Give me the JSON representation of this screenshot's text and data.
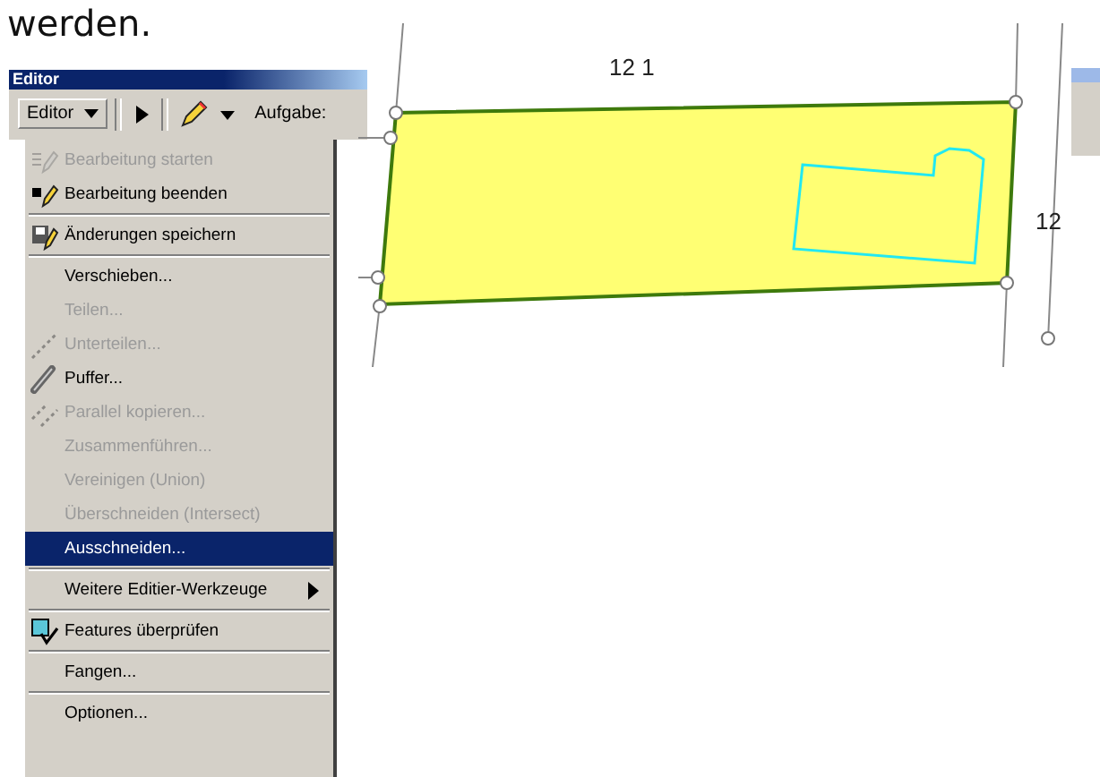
{
  "heading": "werden.",
  "editor_toolbar": {
    "title": "Editor",
    "menu_button": "Editor",
    "task_label": "Aufgabe:"
  },
  "menu": [
    {
      "kind": "item",
      "label": "Bearbeitung starten",
      "disabled": true,
      "selected": false
    },
    {
      "kind": "item",
      "label": "Bearbeitung beenden",
      "disabled": false,
      "selected": false
    },
    {
      "kind": "separator"
    },
    {
      "kind": "item",
      "label": "Änderungen speichern",
      "disabled": false,
      "selected": false
    },
    {
      "kind": "separator"
    },
    {
      "kind": "item",
      "label": "Verschieben...",
      "disabled": false,
      "selected": false
    },
    {
      "kind": "item",
      "label": "Teilen...",
      "disabled": true,
      "selected": false
    },
    {
      "kind": "item",
      "label": "Unterteilen...",
      "disabled": true,
      "selected": false
    },
    {
      "kind": "item",
      "label": "Puffer...",
      "disabled": false,
      "selected": false
    },
    {
      "kind": "item",
      "label": "Parallel kopieren...",
      "disabled": true,
      "selected": false
    },
    {
      "kind": "item",
      "label": "Zusammenführen...",
      "disabled": true,
      "selected": false
    },
    {
      "kind": "item",
      "label": "Vereinigen (Union)",
      "disabled": true,
      "selected": false
    },
    {
      "kind": "item",
      "label": "Überschneiden (Intersect)",
      "disabled": true,
      "selected": false
    },
    {
      "kind": "item",
      "label": "Ausschneiden...",
      "disabled": false,
      "selected": true
    },
    {
      "kind": "separator"
    },
    {
      "kind": "submenu",
      "label": "Weitere Editier-Werkzeuge",
      "disabled": false,
      "selected": false
    },
    {
      "kind": "separator"
    },
    {
      "kind": "item",
      "label": "Features überprüfen",
      "disabled": false,
      "selected": false
    },
    {
      "kind": "separator"
    },
    {
      "kind": "item",
      "label": "Fangen...",
      "disabled": false,
      "selected": false
    },
    {
      "kind": "separator"
    },
    {
      "kind": "item",
      "label": "Optionen...",
      "disabled": false,
      "selected": false
    }
  ],
  "map": {
    "labels": [
      "12 1",
      "12"
    ]
  }
}
